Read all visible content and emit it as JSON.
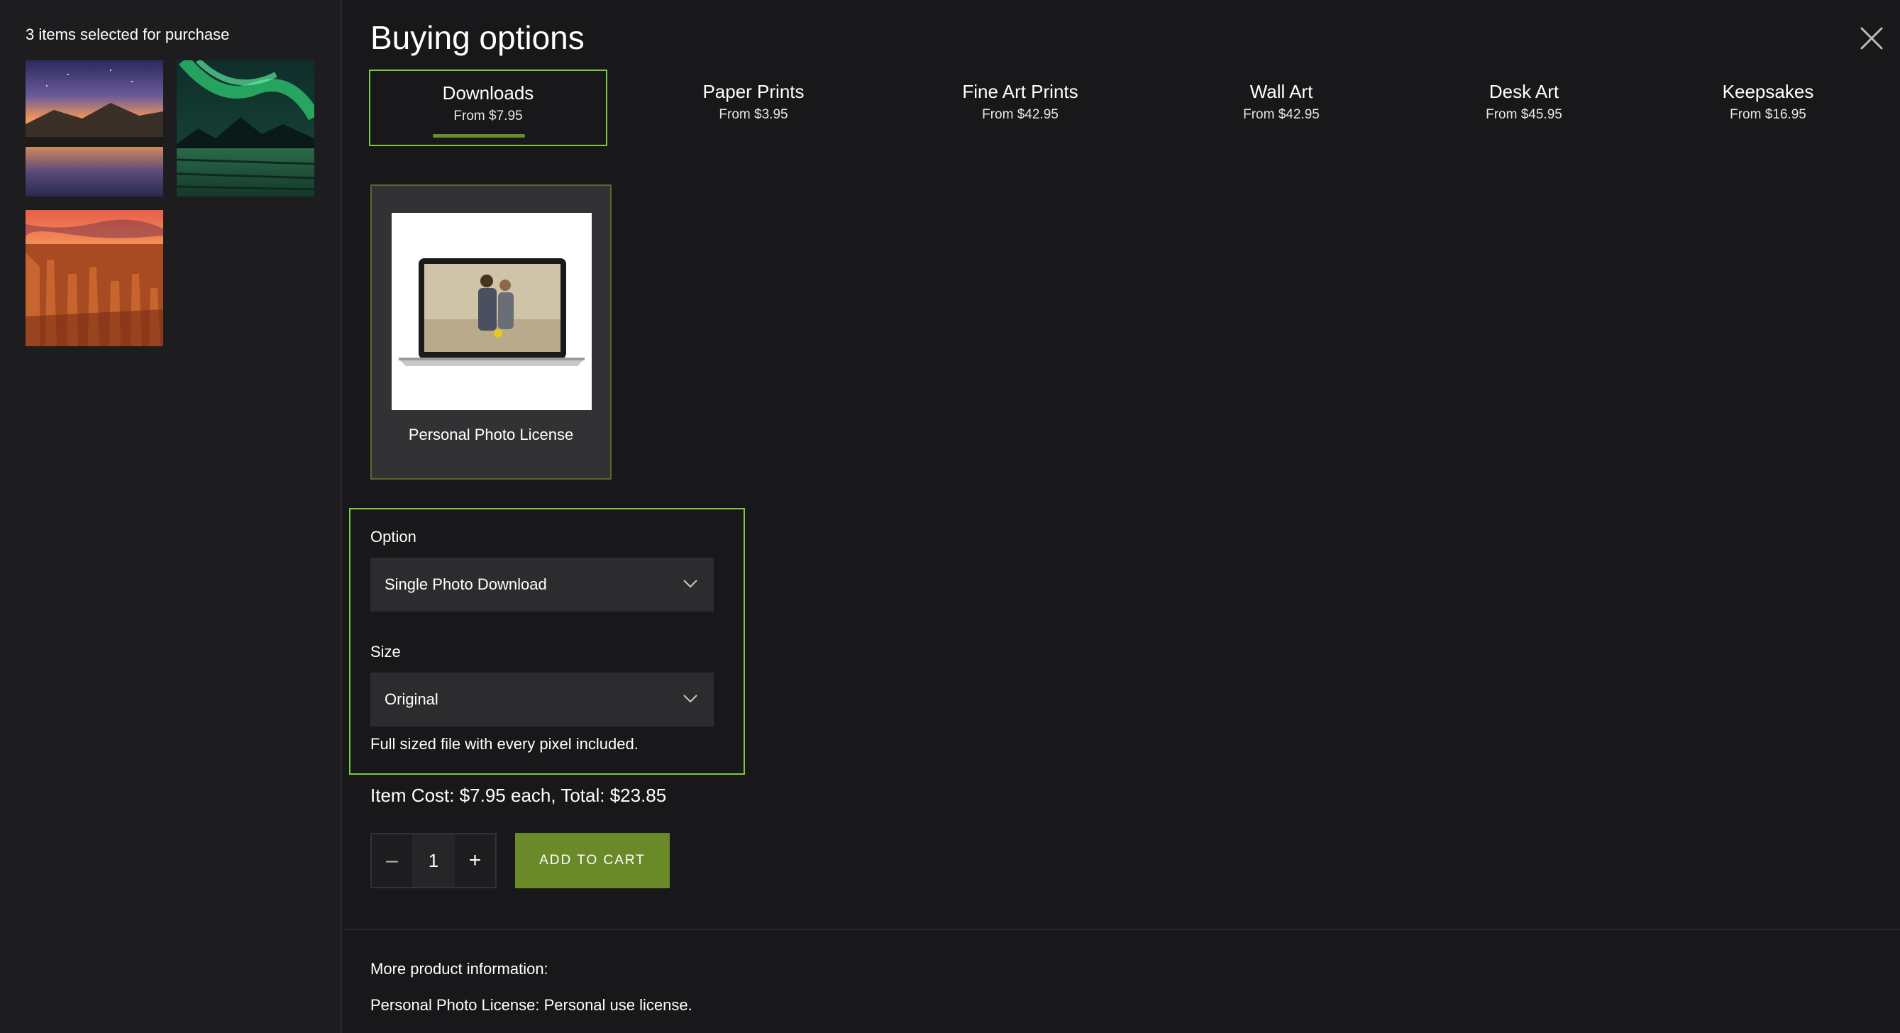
{
  "sidebar": {
    "title": "3 items selected for purchase",
    "thumbnails": [
      {
        "name": "mountain-lake-sunset"
      },
      {
        "name": "aurora-borealis"
      },
      {
        "name": "canyon-hoodoos-sunset"
      }
    ]
  },
  "header": {
    "title": "Buying options",
    "close_icon": "close-icon"
  },
  "tabs": [
    {
      "label": "Downloads",
      "price": "From $7.95",
      "active": true
    },
    {
      "label": "Paper Prints",
      "price": "From $3.95"
    },
    {
      "label": "Fine Art Prints",
      "price": "From $42.95"
    },
    {
      "label": "Wall Art",
      "price": "From $42.95"
    },
    {
      "label": "Desk Art",
      "price": "From $45.95"
    },
    {
      "label": "Keepsakes",
      "price": "From $16.95"
    }
  ],
  "product": {
    "name": "Personal Photo License"
  },
  "options": {
    "option_label": "Option",
    "option_value": "Single Photo Download",
    "size_label": "Size",
    "size_value": "Original",
    "size_note": "Full sized file with every pixel included."
  },
  "cost": {
    "text": "Item Cost: $7.95 each, Total: $23.85"
  },
  "quantity": {
    "minus": "–",
    "value": "1",
    "plus": "+"
  },
  "cart": {
    "add_label": "ADD TO CART"
  },
  "info": {
    "title": "More product information:",
    "text": "Personal Photo License: Personal use license."
  },
  "colors": {
    "accent": "#7ac943",
    "button": "#6a8a2a",
    "background": "#18181a"
  }
}
